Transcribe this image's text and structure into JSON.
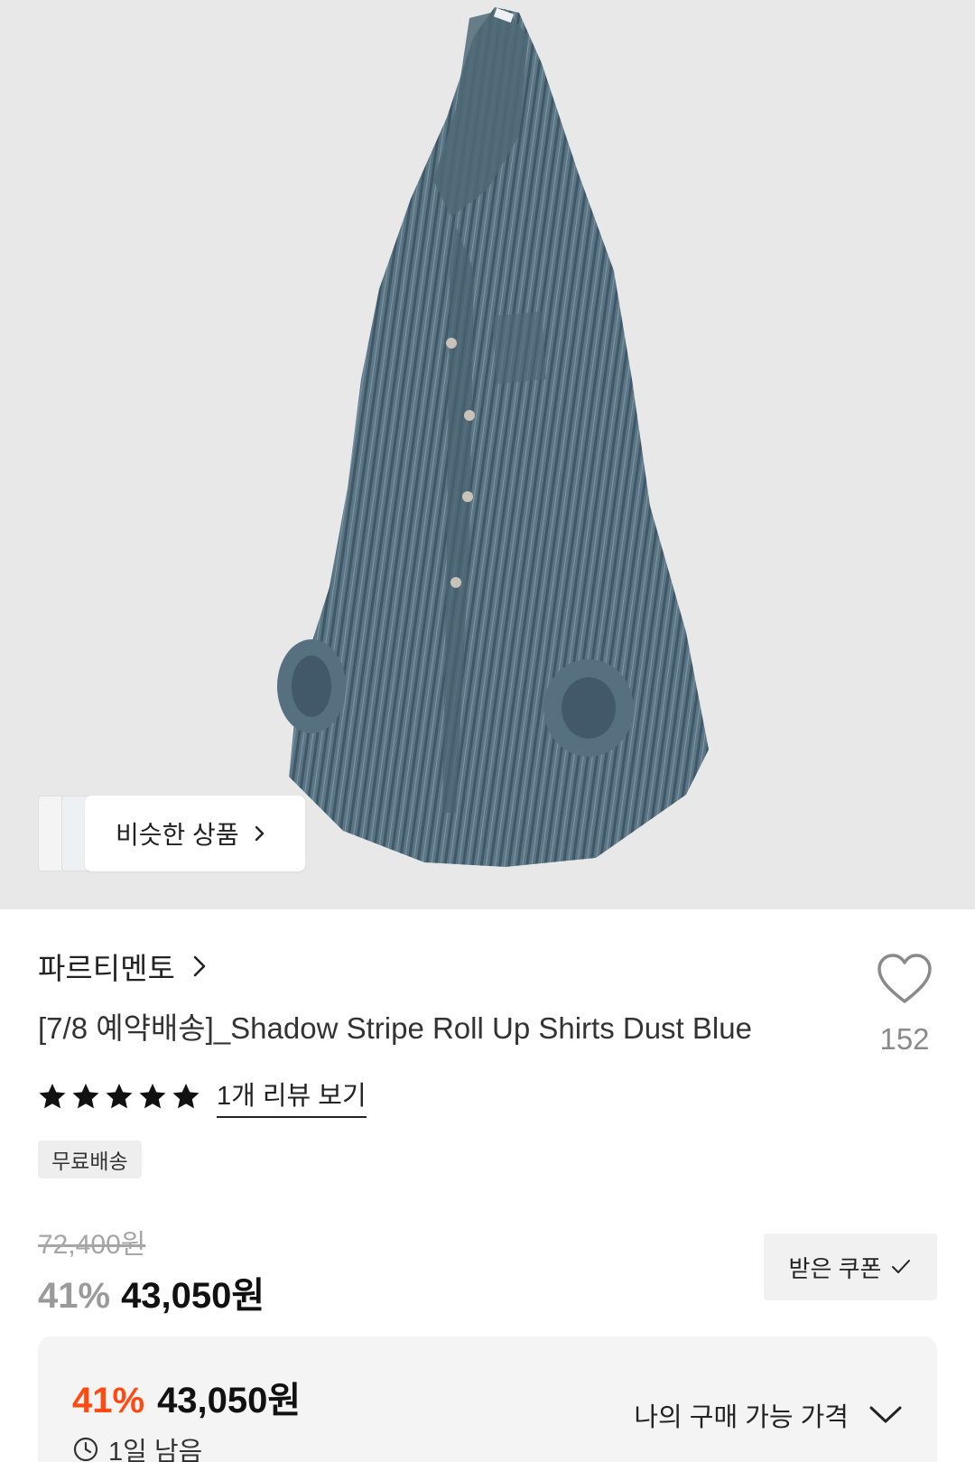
{
  "hero": {
    "image_icon": "striped-shirt-image",
    "similar_products_label": "비슷한 상품"
  },
  "product": {
    "brand": "파르티멘토",
    "title": "[7/8 예약배송]_Shadow Stripe Roll Up Shirts Dust Blue",
    "like_count": "152",
    "rating_stars": 5,
    "review_link": "1개 리뷰 보기",
    "shipping_badge": "무료배송"
  },
  "price": {
    "original": "72,400원",
    "discount_pct": "41%",
    "sale": "43,050원",
    "coupon_button": "받은 쿠폰"
  },
  "my_price": {
    "discount_pct": "41%",
    "price": "43,050원",
    "remaining": "1일 남음",
    "toggle_label": "나의 구매 가능 가격"
  },
  "colors": {
    "accent_orange": "#ff4a12",
    "hero_bg": "#e8e8e9",
    "shirt_blue": "#5b7585"
  }
}
